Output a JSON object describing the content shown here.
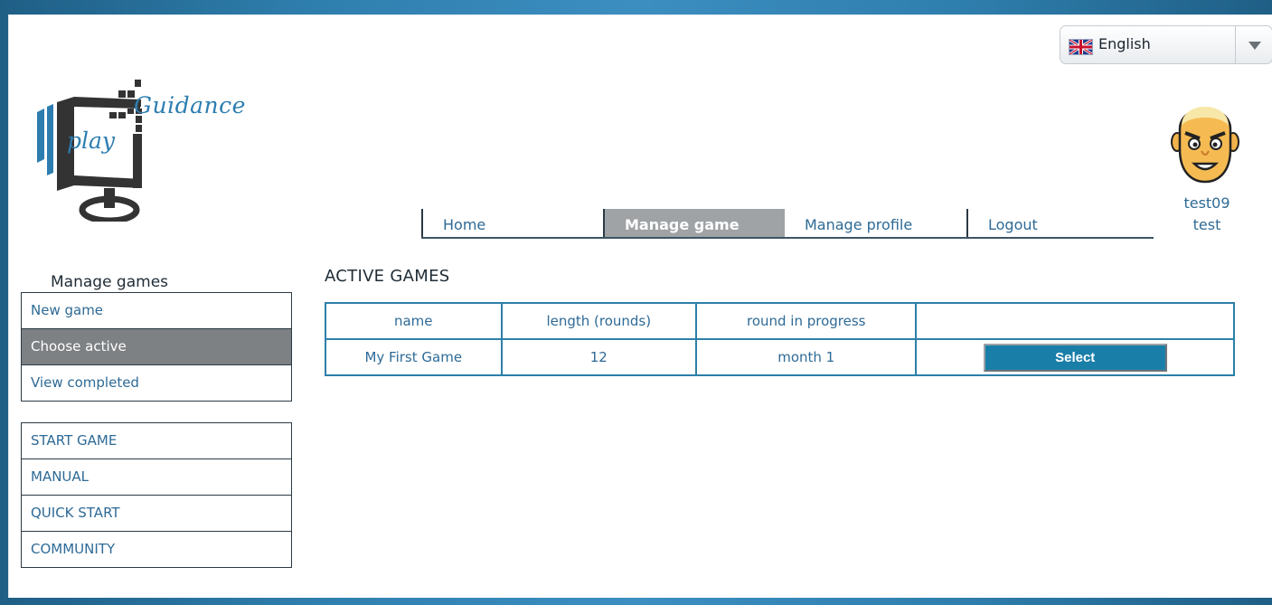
{
  "app": {
    "brand_word": "Guidance",
    "brand_prefix": "play"
  },
  "language": {
    "selected": "English",
    "icon": "uk-flag-icon"
  },
  "nav": {
    "items": [
      {
        "label": "Home"
      },
      {
        "label": "Manage game",
        "active": true
      },
      {
        "label": "Manage profile"
      },
      {
        "label": "Logout"
      }
    ]
  },
  "user": {
    "name": "test09",
    "subtitle": "test"
  },
  "sidebar": {
    "title": "Manage games",
    "group1": [
      {
        "label": "New game"
      },
      {
        "label": "Choose active",
        "active": true
      },
      {
        "label": "View completed"
      }
    ],
    "group2": [
      {
        "label": "START GAME"
      },
      {
        "label": "MANUAL"
      },
      {
        "label": "QUICK START"
      },
      {
        "label": "COMMUNITY"
      }
    ]
  },
  "main": {
    "title": "ACTIVE GAMES",
    "table": {
      "headers": [
        "name",
        "length (rounds)",
        "round in progress",
        ""
      ],
      "rows": [
        {
          "name": "My First Game",
          "length": "12",
          "round": "month 1",
          "action": "Select"
        }
      ]
    }
  },
  "colors": {
    "accent": "#1a7fa8",
    "link": "#2e6a96",
    "border": "#2d7fa8",
    "active_nav": "#9fa3a6"
  }
}
